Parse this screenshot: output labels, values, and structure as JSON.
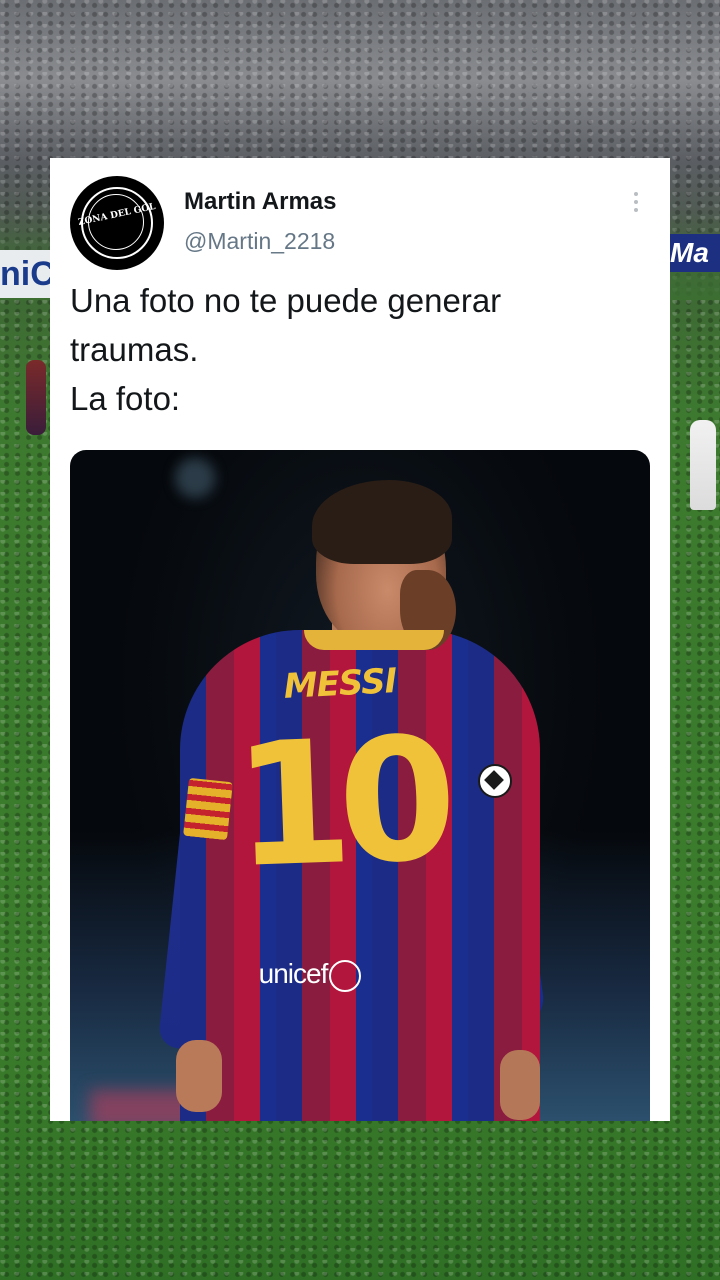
{
  "tweet": {
    "author_name": "Martin Armas",
    "author_handle": "@Martin_2218",
    "avatar_logo_text": "ZONA DEL GOL",
    "text_lines": [
      "Una foto no te puede generar",
      "traumas.",
      "La foto:"
    ],
    "more_icon": "more-vertical-icon"
  },
  "photo": {
    "jersey_name": "MESSI",
    "jersey_number": "10",
    "sponsor": "unicef"
  },
  "background": {
    "ad_left": "niC",
    "ad_right": "Ma"
  },
  "colors": {
    "card_background": "#ffffff",
    "name_text": "#14171a",
    "handle_text": "#657786",
    "jersey_gold": "#f0c23a",
    "jersey_blue": "#1c2b86",
    "jersey_red": "#b2163d"
  }
}
